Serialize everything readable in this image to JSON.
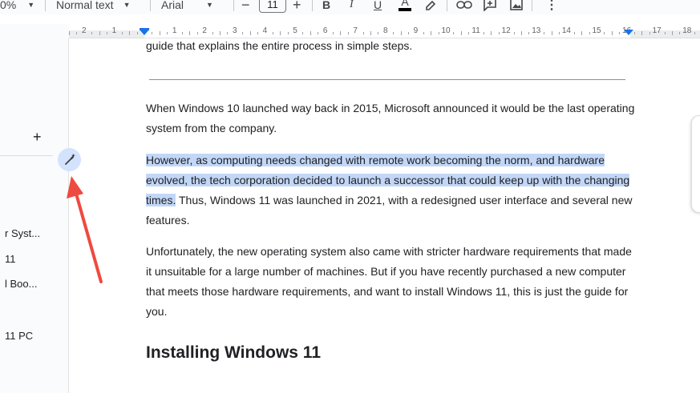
{
  "toolbar": {
    "zoom": "0%",
    "style": "Normal text",
    "font": "Arial",
    "minus": "−",
    "font_size": "11",
    "plus": "+",
    "bold": "B",
    "italic": "I",
    "underline": "U",
    "text_color": "A"
  },
  "ruler": {
    "numbers": [
      "2",
      "1",
      "1",
      "2",
      "3",
      "4",
      "5",
      "6",
      "7",
      "8",
      "9",
      "10",
      "11",
      "12",
      "13",
      "14",
      "15",
      "16",
      "17",
      "18"
    ]
  },
  "sidebar": {
    "add_label": "+",
    "items": [
      "r Syst...",
      "11",
      "l Boo...",
      "11 PC"
    ]
  },
  "document": {
    "top_line": "guide that explains the entire process in simple steps.",
    "p1": "When Windows 10 launched way back in 2015, Microsoft announced it would be the last operating system from the company.",
    "p2_highlighted": "However, as computing needs changed with remote work becoming the norm, and hardware evolved, the tech corporation decided to launch a successor that could keep up with the changing times.",
    "p2_rest": " Thus, Windows 11 was launched in 2021, with a redesigned user interface and several new features.",
    "p3": "Unfortunately, the new operating system also came with stricter hardware requirements that made it unsuitable for a large number of machines. But if you have recently purchased a new computer that meets those hardware requirements, and want to install Windows 11, this is just the guide for you.",
    "heading": "Installing Windows 11"
  },
  "colors": {
    "highlight": "#c2d7f7",
    "accent_blue": "#1a73e8",
    "annotation_arrow": "#ef4a3f",
    "edit_button_bg": "#d3e3fd"
  }
}
